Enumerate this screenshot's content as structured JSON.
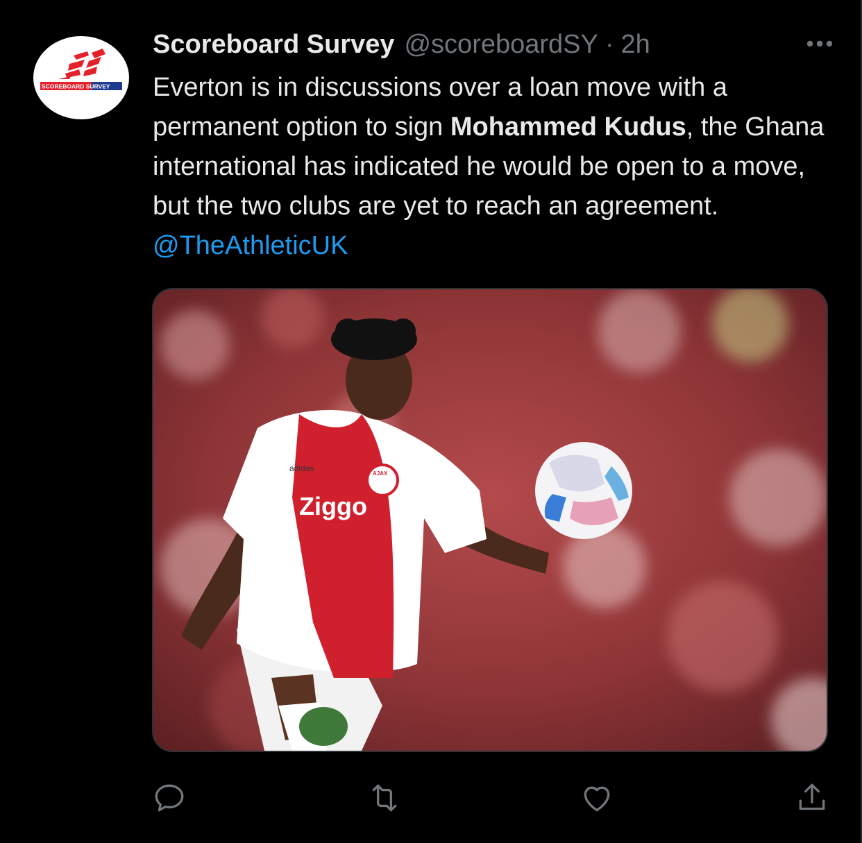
{
  "tweet": {
    "display_name": "Scoreboard Survey",
    "handle": "@scoreboardSY",
    "separator": "·",
    "timestamp": "2h",
    "text_part1": "Everton is in discussions over a loan move with a permanent option to sign ",
    "text_bold": "Mohammed Kudus",
    "text_part2": ", the Ghana international has indicated he would be open to a move, but the two clubs are yet to reach an agreement. ",
    "mention": "@TheAthleticUK",
    "avatar_logo_text": "SCOREBOARD SURVEY"
  },
  "media": {
    "shirt_sponsor": "Ziggo",
    "kit_brand": "adidas",
    "crest_text": "AJAX"
  },
  "actions": {
    "reply_icon": "reply-icon",
    "retweet_icon": "retweet-icon",
    "like_icon": "like-icon",
    "share_icon": "share-icon"
  },
  "colors": {
    "background": "#000000",
    "text": "#e7e9ea",
    "muted": "#71767b",
    "link": "#1d9bf0",
    "border": "#2f3336"
  }
}
